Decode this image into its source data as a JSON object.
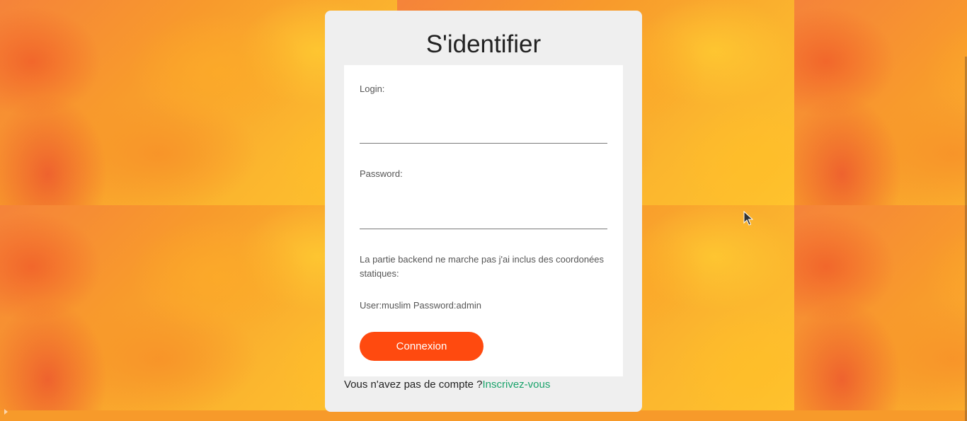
{
  "colors": {
    "accent_button": "#ff4a0f",
    "link": "#1aa36b",
    "card_bg": "#efefef",
    "panel_bg": "#ffffff"
  },
  "login_card": {
    "title": "S'identifier",
    "login_label": "Login:",
    "login_value": "",
    "password_label": "Password:",
    "password_value": "",
    "note": "La partie backend ne marche pas j'ai inclus des coordonées statiques:",
    "credentials": "User:muslim Password:admin",
    "submit_label": "Connexion",
    "signup_prompt": "Vous n'avez pas de compte ?",
    "signup_link": "Inscrivez-vous"
  },
  "icons": {
    "cursor": "mouse-pointer-icon"
  }
}
